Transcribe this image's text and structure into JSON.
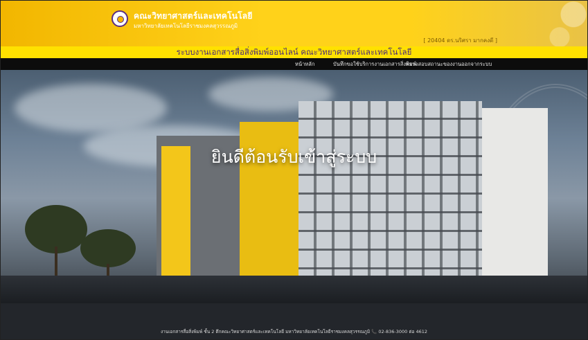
{
  "header": {
    "brand_title": "คณะวิทยาศาสตร์และเทคโนโลยี",
    "brand_subtitle": "มหาวิทยาลัยเทคโนโลยีราชมงคลสุวรรณภูมิ",
    "user_info": "[ 20404  ดร.นริศรา มากคงดี ]"
  },
  "title_bar": "ระบบงานเอกสารสื่อสิ่งพิมพ์ออนไลน์ คณะวิทยาศาสตร์และเทคโนโลยี",
  "nav": {
    "items": [
      {
        "label": "หน้าหลัก"
      },
      {
        "label": "บันทึกขอใช้บริการงานเอกสารสิ่งพิมพ์"
      },
      {
        "label": "ตรวจสอบสถานะของงาน"
      },
      {
        "label": "ออกจากระบบ"
      }
    ]
  },
  "hero": {
    "welcome": "ยินดีต้อนรับเข้าสู่ระบบ"
  },
  "footer": {
    "text": "งานเอกสารสื่อสิ่งพิมพ์ ชั้น 2 ตึกคณะวิทยาศาสตร์และเทคโนโลยี มหาวิทยาลัยเทคโนโลยีราชมงคลสุวรรณภูมิ  📞  02-836-3000 ต่อ 4612"
  },
  "colors": {
    "header_yellow": "#ffd21a",
    "title_bar_yellow": "#ffe100",
    "nav_black": "#0c0c0c",
    "title_text_purple": "#4a2a7a"
  }
}
